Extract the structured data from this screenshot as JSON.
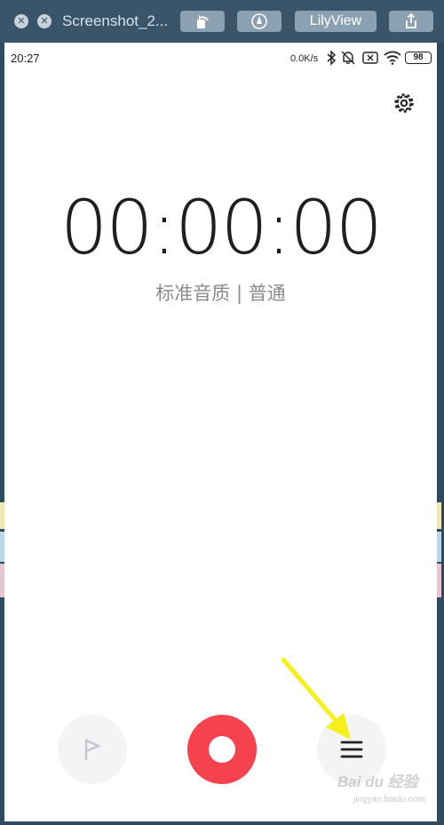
{
  "viewer": {
    "title": "Screenshot_2...",
    "rotate_icon": "rotate-icon",
    "markup_icon": "markup-pen-icon",
    "app_button_label": "LilyView",
    "share_icon": "share-icon"
  },
  "status_bar": {
    "time": "20:27",
    "net_speed": "0.0K/s",
    "battery": "98"
  },
  "recorder": {
    "timer": "00:00:00",
    "quality_label": "标准音质 | 普通"
  },
  "watermark": {
    "main": "Bai du 经验",
    "sub": "jingyan.baidu.com"
  },
  "colors": {
    "record": "#f5424e",
    "arrow": "#f5ef1b",
    "viewer_bar": "#3a5569"
  }
}
